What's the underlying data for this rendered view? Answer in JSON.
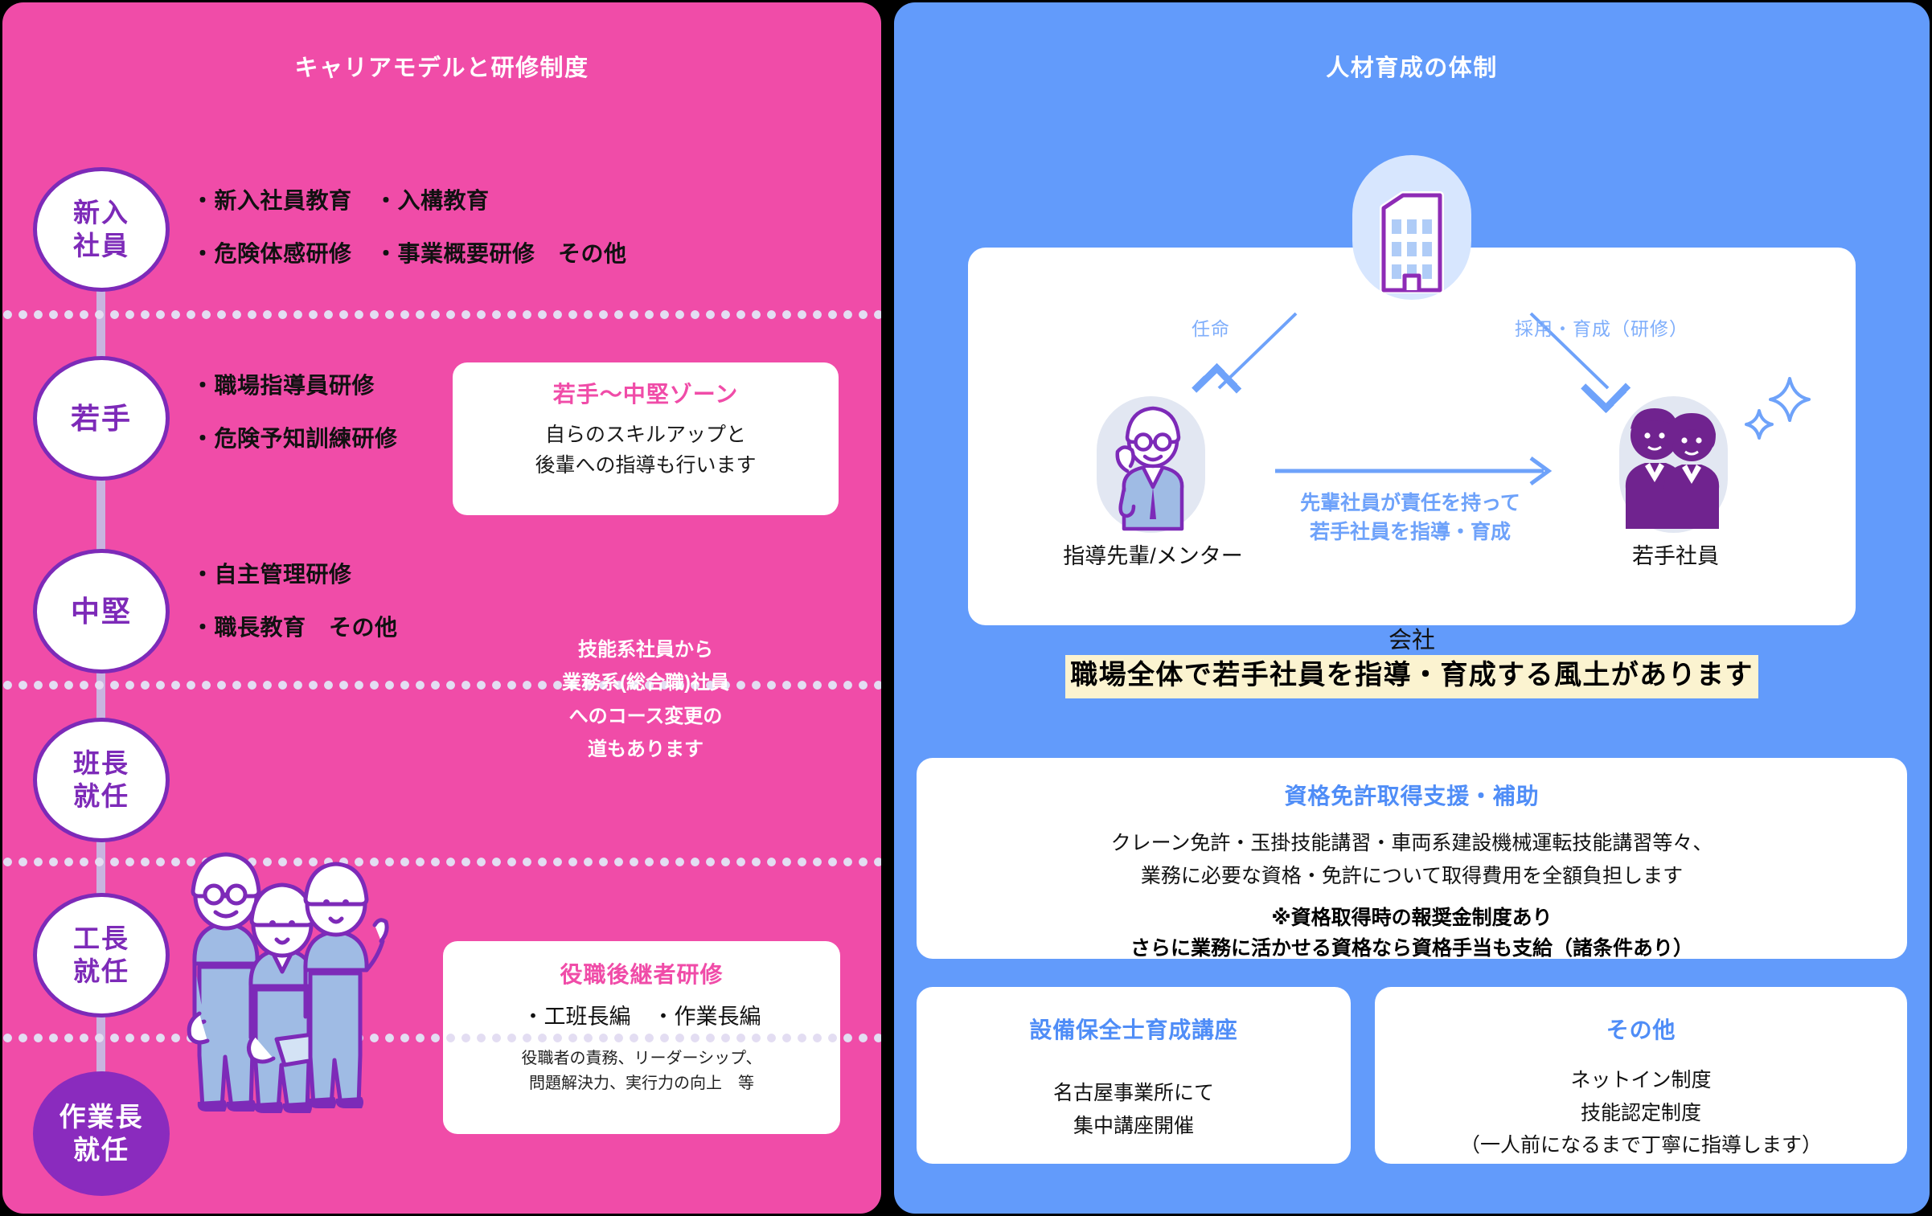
{
  "left_panel": {
    "title": "キャリアモデルと研修制度",
    "accent_pink": "#F04CA8",
    "accent_purple": "#7D2AB8",
    "stages": [
      {
        "name": "新入社員",
        "lines": [
          "新入",
          "社員"
        ],
        "bullets": [
          "・新入社員教育　・入構教育",
          "・危険体感研修　・事業概要研修　その他"
        ]
      },
      {
        "name": "若手",
        "lines": [
          "若手"
        ],
        "bullets": [
          "・職場指導員研修",
          "・危険予知訓練研修"
        ]
      },
      {
        "name": "中堅",
        "lines": [
          "中堅"
        ],
        "bullets": [
          "・自主管理研修",
          "・職長教育　その他"
        ]
      },
      {
        "name": "班長就任",
        "lines": [
          "班長",
          "就任"
        ],
        "bullets": []
      },
      {
        "name": "工長就任",
        "lines": [
          "工長",
          "就任"
        ],
        "bullets": []
      },
      {
        "name": "作業長就任",
        "lines": [
          "作業長",
          "就任"
        ],
        "bullets": [],
        "filled": true
      }
    ],
    "zone_callout": {
      "title": "若手〜中堅ゾーン",
      "lines": [
        "自らのスキルアップと",
        "後輩への指導も行います"
      ]
    },
    "course_change_note": [
      "技能系社員から",
      "業務系(総合職)社員",
      "へのコース変更の",
      "道もあります"
    ],
    "successor_callout": {
      "title": "役職後継者研修",
      "main": "・工班長編　・作業長編",
      "sub": [
        "役職者の責務、リーダーシップ、",
        "問題解決力、実行力の向上　等"
      ]
    }
  },
  "right_panel": {
    "title": "人材育成の体制",
    "accent_blue": "#629BFB",
    "accent_blue_text": "#4F8DF7",
    "mentor_diagram": {
      "company_label": "会社",
      "arrow_left_label": "任命",
      "arrow_right_label": "採用・育成（研修）",
      "left_figure_label": "指導先輩/メンター",
      "right_figure_label": "若手社員",
      "middle_arrow_text": [
        "先輩社員が責任を持って",
        "若手社員を指導・育成"
      ]
    },
    "highlight": "職場全体で若手社員を指導・育成する風土があります",
    "cards": [
      {
        "title": "資格免許取得支援・補助",
        "lines": [
          "クレーン免許・玉掛技能講習・車両系建設機械運転技能講習等々、",
          "業務に必要な資格・免許について取得費用を全額負担します"
        ],
        "bold_lines": [
          "※資格取得時の報奨金制度あり",
          "さらに業務に活かせる資格なら資格手当も支給（諸条件あり）"
        ]
      },
      {
        "title": "設備保全士育成講座",
        "lines": [
          "名古屋事業所にて",
          "集中講座開催"
        ],
        "bold_lines": []
      },
      {
        "title": "その他",
        "lines": [
          "ネットイン制度",
          "技能認定制度",
          "（一人前になるまで丁寧に指導します）"
        ],
        "bold_lines": []
      }
    ]
  }
}
